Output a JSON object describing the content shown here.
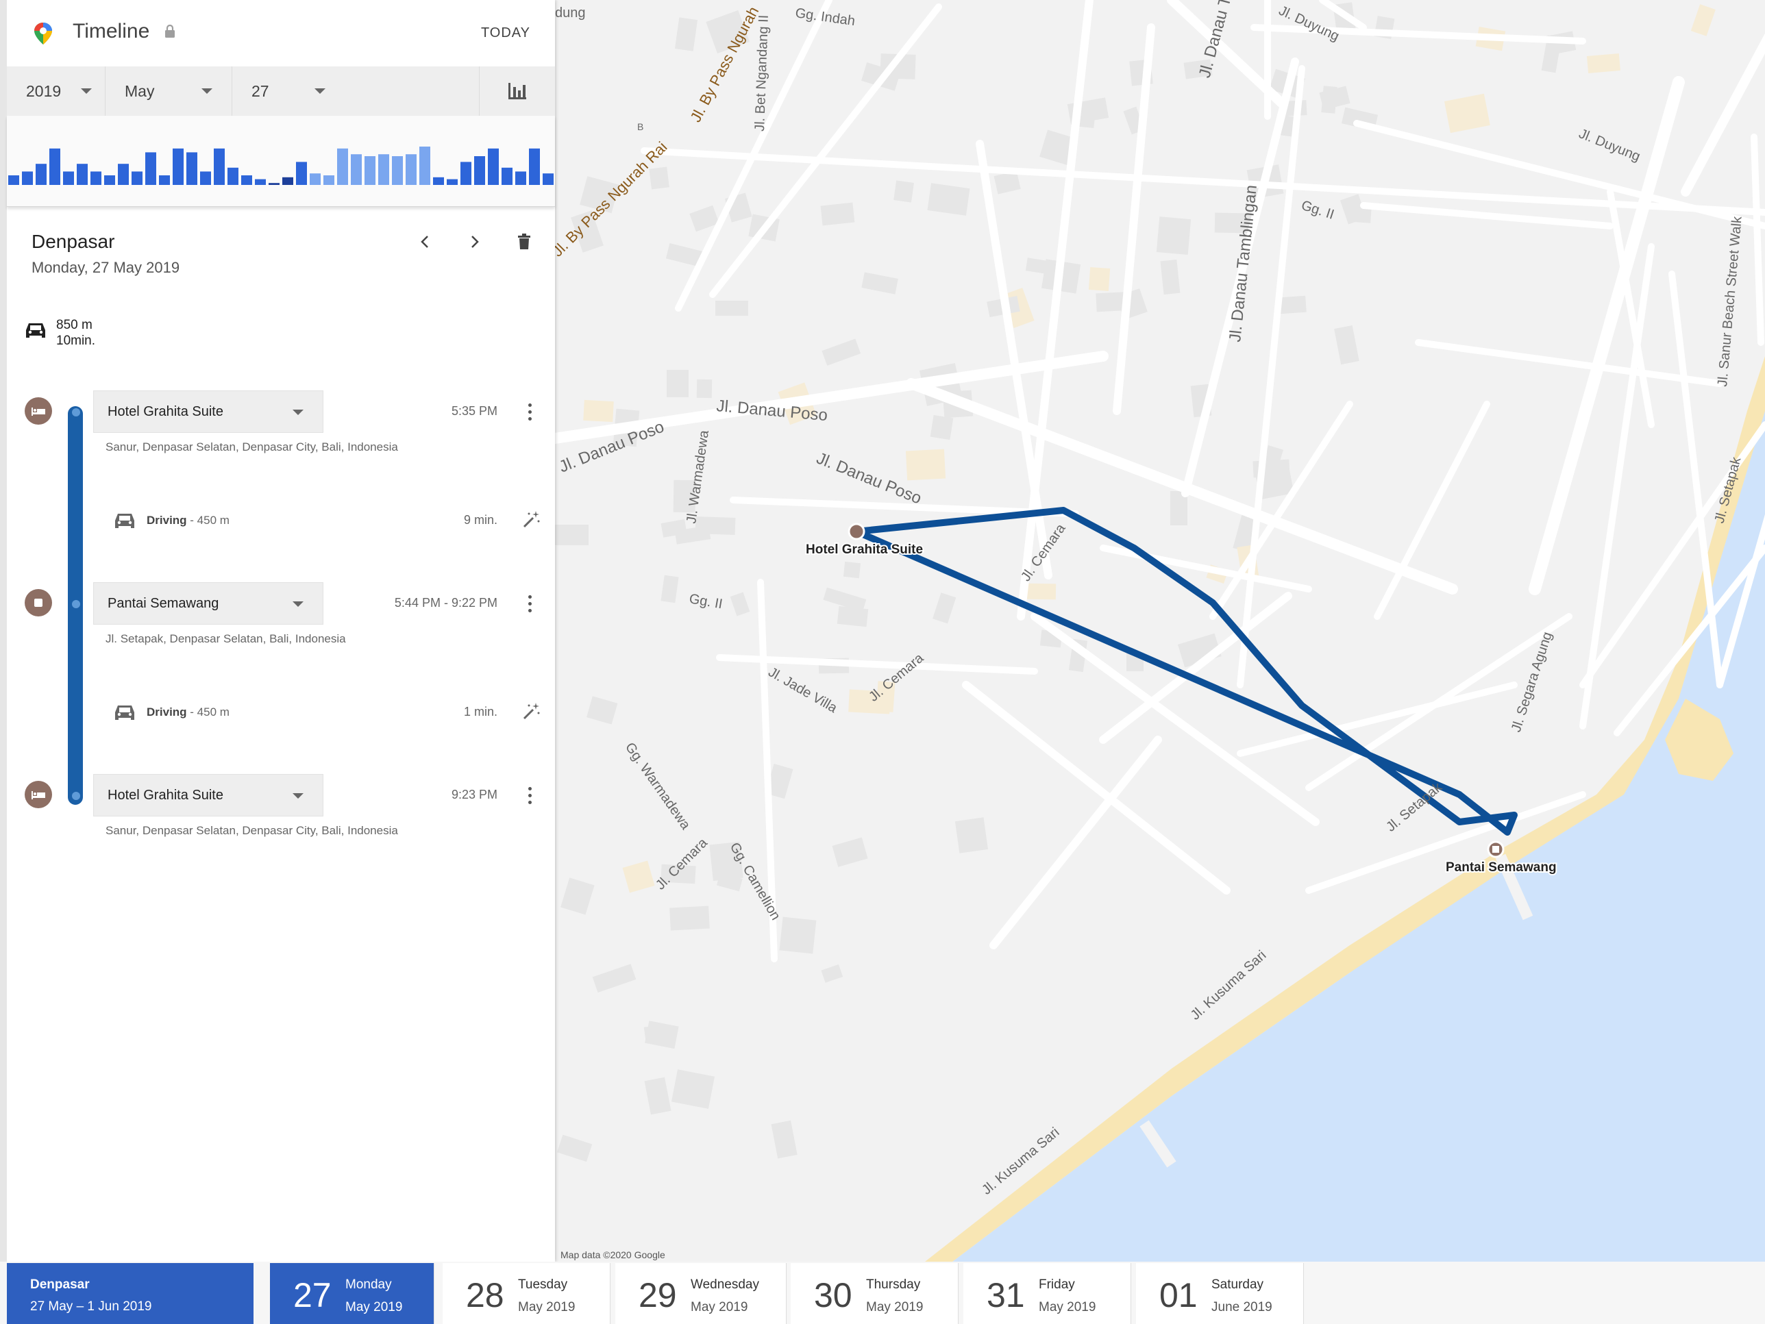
{
  "header": {
    "title": "Timeline",
    "today_label": "TODAY"
  },
  "date_selector": {
    "year": "2019",
    "month": "May",
    "day": "27"
  },
  "histogram": {
    "bar_levels": [
      0.25,
      0.35,
      0.55,
      0.95,
      0.35,
      0.55,
      0.35,
      0.25,
      0.55,
      0.35,
      0.85,
      0.25,
      0.95,
      0.85,
      0.35,
      0.95,
      0.45,
      0.25,
      0.15,
      0.05,
      0.2,
      0.6,
      0.3,
      0.25,
      0.95,
      0.8,
      0.75,
      0.8,
      0.75,
      0.8,
      1.0,
      0.2,
      0.15,
      0.6,
      0.75,
      0.95,
      0.45,
      0.35,
      0.95,
      0.3
    ]
  },
  "place": {
    "title": "Denpasar",
    "date": "Monday, 27 May 2019"
  },
  "summary": {
    "distance": "850 m",
    "duration": "10min."
  },
  "timeline": [
    {
      "type": "stay",
      "icon": "hotel-icon",
      "name": "Hotel Grahita Suite",
      "time": "5:35 PM",
      "address": "Sanur, Denpasar Selatan, Denpasar City, Bali, Indonesia"
    },
    {
      "type": "move",
      "mode": "Driving",
      "distance": "- 450 m",
      "duration": "9 min."
    },
    {
      "type": "stay",
      "icon": "place-icon",
      "name": "Pantai Semawang",
      "time": "5:44 PM - 9:22 PM",
      "address": "Jl. Setapak, Denpasar Selatan, Bali, Indonesia"
    },
    {
      "type": "move",
      "mode": "Driving",
      "distance": "- 450 m",
      "duration": "1 min."
    },
    {
      "type": "stay",
      "icon": "hotel-icon",
      "name": "Hotel Grahita Suite",
      "time": "9:23 PM",
      "address": "Sanur, Denpasar Selatan, Denpasar City, Bali, Indonesia"
    }
  ],
  "map": {
    "credit": "Map data ©2020 Google",
    "markers": {
      "hotel": "Hotel Grahita Suite",
      "beach": "Pantai Semawang"
    },
    "street_labels": [
      "Jl. By Pass Ngurah Rai",
      "Jl. By Pass Ngurah",
      "Jl. Bet Ngandang II",
      "Gg. Indah",
      "Jl. Danau Tamblingan",
      "Jl. Danau Tam",
      "Jl. Duyung",
      "Gg. II",
      "Jl. Segara Agung",
      "Jl. Sanur Beach Street Walk",
      "Jl. Danau Poso",
      "Jl. Warmadewa",
      "Jl. Cemara",
      "Jl. Kusuma Sari",
      "Jl. Setapak",
      "Jl. Jade Villa",
      "Gg. Warmadewa",
      "Gg. Camellion",
      "B",
      "dung"
    ]
  },
  "bottom_bar": {
    "trip": {
      "name": "Denpasar",
      "range": "27 May – 1 Jun 2019"
    },
    "days": [
      {
        "num": "27",
        "weekday": "Monday",
        "month": "May 2019",
        "active": true
      },
      {
        "num": "28",
        "weekday": "Tuesday",
        "month": "May 2019"
      },
      {
        "num": "29",
        "weekday": "Wednesday",
        "month": "May 2019"
      },
      {
        "num": "30",
        "weekday": "Thursday",
        "month": "May 2019"
      },
      {
        "num": "31",
        "weekday": "Friday",
        "month": "May 2019"
      },
      {
        "num": "01",
        "weekday": "Saturday",
        "month": "June 2019"
      }
    ]
  },
  "colors": {
    "route": "#0d4f96",
    "accent": "#2e5fbf",
    "water": "#cfe3fb",
    "sand": "#f8e6b4",
    "pin": "#8d6e63",
    "hist_dark": "#2d65d9",
    "hist_light": "#7aa6ef"
  }
}
